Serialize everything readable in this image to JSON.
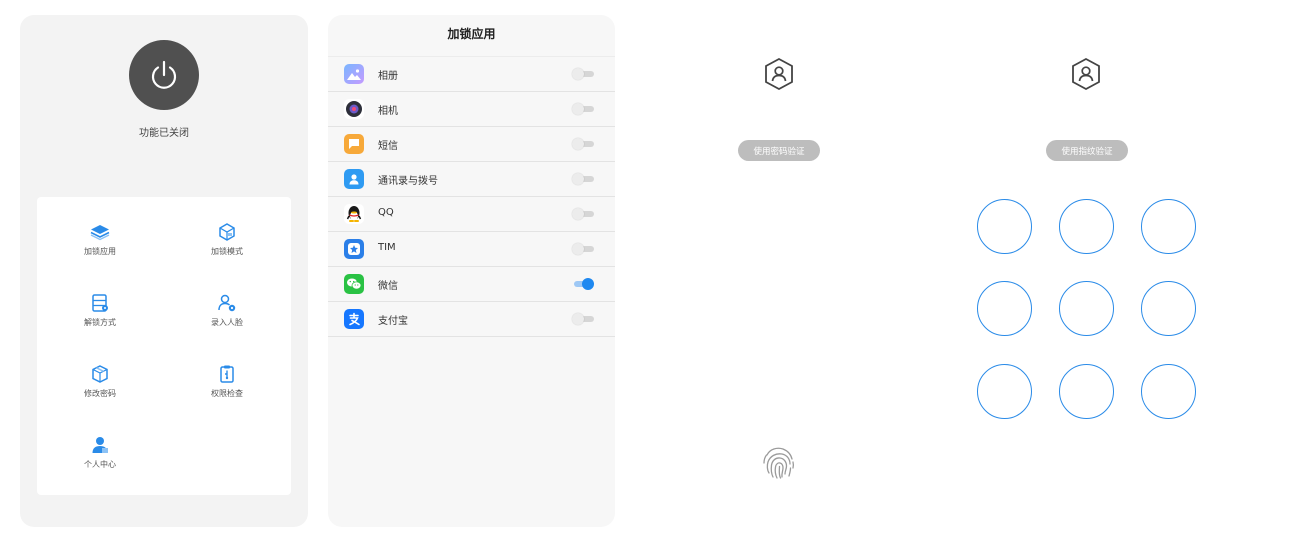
{
  "main_menu": {
    "power_status": "功能已关闭",
    "items": [
      {
        "label": "加锁应用",
        "icon": "layers-icon"
      },
      {
        "label": "加锁模式",
        "icon": "cube-lock-icon"
      },
      {
        "label": "解锁方式",
        "icon": "server-settings-icon"
      },
      {
        "label": "录入人脸",
        "icon": "user-gear-icon"
      },
      {
        "label": "修改密码",
        "icon": "box-icon"
      },
      {
        "label": "权限检查",
        "icon": "clipboard-check-icon"
      },
      {
        "label": "个人中心",
        "icon": "person-icon"
      }
    ]
  },
  "app_list": {
    "title": "加锁应用",
    "apps": [
      {
        "name": "相册",
        "icon": "gallery-icon",
        "locked": false
      },
      {
        "name": "相机",
        "icon": "camera-icon",
        "locked": false
      },
      {
        "name": "短信",
        "icon": "message-icon",
        "locked": false
      },
      {
        "name": "通讯录与拨号",
        "icon": "contacts-icon",
        "locked": false
      },
      {
        "name": "QQ",
        "icon": "qq-penguin-icon",
        "locked": false
      },
      {
        "name": "TIM",
        "icon": "tim-icon",
        "locked": false
      },
      {
        "name": "微信",
        "icon": "wechat-icon",
        "locked": true
      },
      {
        "name": "支付宝",
        "icon": "alipay-icon",
        "locked": false
      }
    ]
  },
  "password_verify": {
    "switch_button": "使用密码验证"
  },
  "pattern_verify": {
    "switch_button": "使用指纹验证"
  },
  "colors": {
    "accent": "#1e88f0",
    "pattern_ring": "#2a8be8",
    "power_button": "#505050",
    "pill": "#bdbdbd"
  }
}
